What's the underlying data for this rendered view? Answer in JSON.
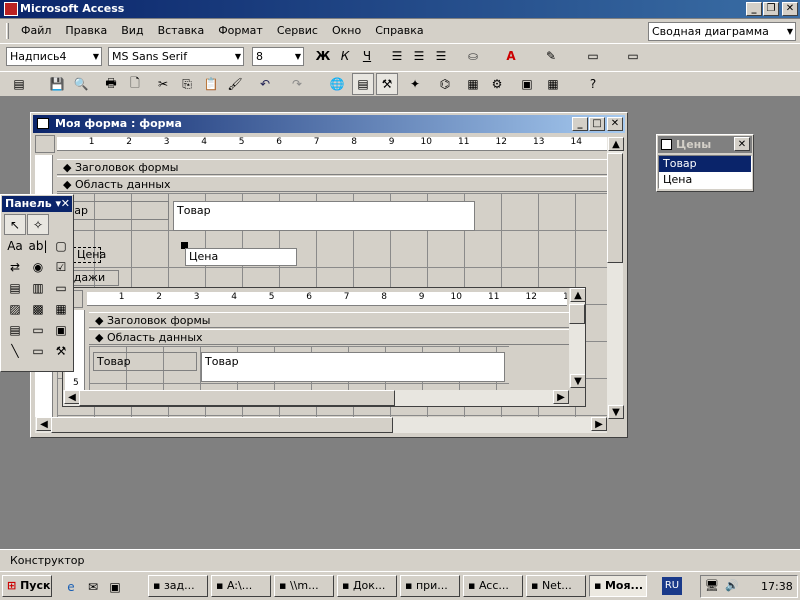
{
  "app": {
    "title": "Microsoft Access"
  },
  "menu": [
    "Файл",
    "Правка",
    "Вид",
    "Вставка",
    "Формат",
    "Сервис",
    "Окно",
    "Справка"
  ],
  "help_box": {
    "value": "Сводная диаграмма"
  },
  "format_toolbar": {
    "object": "Надпись4",
    "font": "MS Sans Serif",
    "size": "8",
    "bold": "Ж",
    "italic": "К",
    "underline": "Ч"
  },
  "form_window": {
    "title": "Моя форма : форма",
    "header_section": "Заголовок формы",
    "detail_section": "Область данных",
    "label_tovar": "овар",
    "field_tovar": "Товар",
    "label_cena": "Цена",
    "field_cena": "Цена",
    "subform_tab": "родажи"
  },
  "subform": {
    "header_section": "Заголовок формы",
    "detail_section": "Область данных",
    "label_tovar": "Товар",
    "field_tovar": "Товар",
    "side_num": "5"
  },
  "field_list": {
    "title": "Цены",
    "items": [
      "Товар",
      "Цена"
    ]
  },
  "toolbox": {
    "title": "Панель"
  },
  "ruler": {
    "marks": [
      "1",
      "2",
      "3",
      "4",
      "5",
      "6",
      "7",
      "8",
      "9",
      "10",
      "11",
      "12",
      "13",
      "14"
    ]
  },
  "status": {
    "text": "Конструктор"
  },
  "taskbar": {
    "start": "Пуск",
    "tasks": [
      "зад...",
      "A:\\...",
      "\\\\m...",
      "Док...",
      "при...",
      "Acc...",
      "Net...",
      "Моя..."
    ],
    "lang": "RU",
    "clock": "17:38"
  }
}
